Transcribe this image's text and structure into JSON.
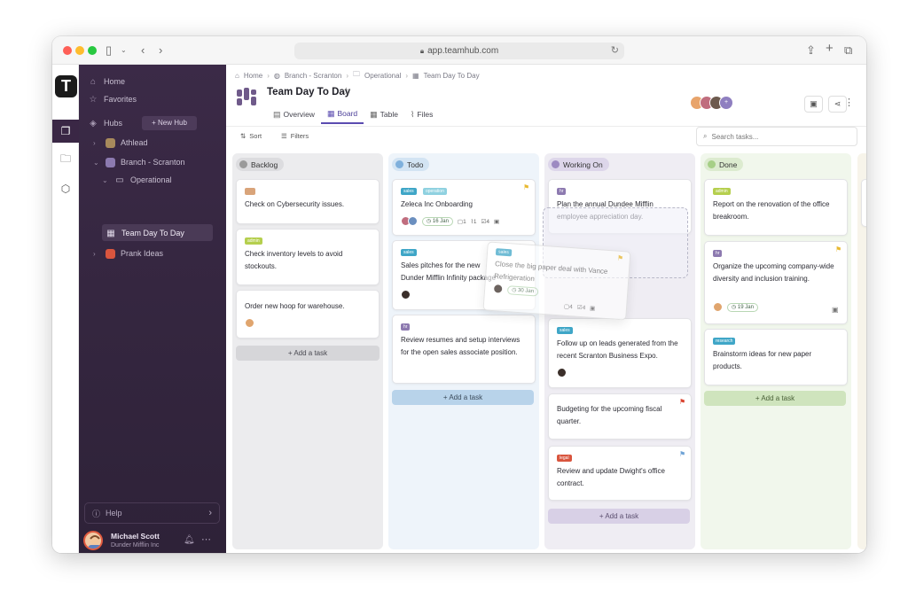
{
  "browser": {
    "url": "app.teamhub.com"
  },
  "rail": {
    "logo": "T"
  },
  "sidebar": {
    "home": "Home",
    "favorites": "Favorites",
    "hubs": "Hubs",
    "new_hub": "+ New Hub",
    "hub_list": [
      {
        "name": "Athlead",
        "color": "#a88a5c"
      },
      {
        "name": "Branch - Scranton",
        "color": "#8c7ab0"
      },
      {
        "name": "Operational"
      },
      {
        "name": "Team Day To Day"
      },
      {
        "name": "Prank Ideas",
        "color": "#d9553e"
      }
    ],
    "help": "Help",
    "user": {
      "name": "Michael Scott",
      "org": "Dunder Mifflin Inc"
    }
  },
  "breadcrumb": [
    "Home",
    "Branch - Scranton",
    "Operational",
    "Team Day To Day"
  ],
  "page": {
    "title": "Team Day To Day",
    "tabs": [
      "Overview",
      "Board",
      "Table",
      "Files"
    ],
    "active_tab": "Board"
  },
  "toolbar": {
    "sort": "Sort",
    "filters": "Filters",
    "search_placeholder": "Search tasks..."
  },
  "columns": [
    {
      "name": "Backlog",
      "color": "#9a9a9a",
      "bg": "#ececee",
      "badge_bg": "#dcdcdf",
      "cards": [
        {
          "tag": "",
          "tag_color": "#d9a47a",
          "text": "Check on Cybersecurity issues."
        },
        {
          "tag": "admin",
          "tag_color": "#b5cf4e",
          "text": "Check inventory levels to avoid stockouts."
        },
        {
          "text": "Order new hoop for warehouse."
        }
      ],
      "add": "+ Add a task"
    },
    {
      "name": "Todo",
      "color": "#7fb0dc",
      "bg": "#eef4fa",
      "badge_bg": "#d3e4f3",
      "cards": [
        {
          "tags": [
            "sales",
            "operation"
          ],
          "text": "Zeleca Inc Onboarding",
          "date": "16 Jan",
          "comments": "1",
          "attachments": "1",
          "checklist": "4"
        },
        {
          "tag": "sales",
          "text": "Sales pitches for the new Dunder Mifflin Infinity package"
        },
        {
          "tag": "hr",
          "text": "Review resumes and setup interviews for the open sales associate position."
        }
      ],
      "add": "+ Add a task"
    },
    {
      "name": "Working On",
      "color": "#9d8ac2",
      "bg": "#efedf3",
      "badge_bg": "#ddd6ea",
      "cards": [
        {
          "tag": "hr",
          "text": "Plan the annual Dundee Mifflin employee appreciation day."
        },
        {
          "tag": "sales",
          "text": "Follow up on leads generated from the recent Scranton Business Expo."
        },
        {
          "text": "Budgeting for the upcoming fiscal quarter."
        },
        {
          "tag": "legal",
          "text": "Review and update Dwight's office contract."
        }
      ],
      "add": "+ Add a task"
    },
    {
      "name": "Done",
      "color": "#a6cf86",
      "bg": "#f1f7ec",
      "badge_bg": "#dcebcf",
      "cards": [
        {
          "tag": "admin",
          "text": "Report on the renovation of the office breakroom."
        },
        {
          "tag": "hr",
          "text": "Organize the upcoming company-wide diversity and inclusion training.",
          "date": "19 Jan"
        },
        {
          "tag": "research",
          "text": "Brainstorm ideas for new paper products."
        }
      ],
      "add": "+ Add a task"
    }
  ],
  "dragging_card": {
    "tag": "sales",
    "text": "Close the big paper deal with Vance Refrigeration",
    "date": "30 Jan",
    "comments": "4",
    "checklist": "4"
  }
}
